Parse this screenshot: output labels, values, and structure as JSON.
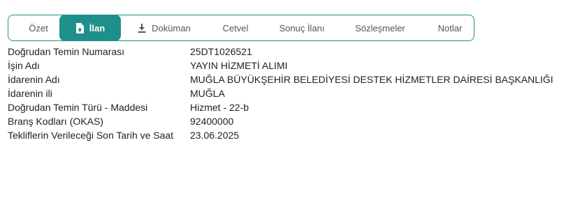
{
  "tabs": {
    "ozet": "Özet",
    "ilan": "İlan",
    "dokuman": "Doküman",
    "cetvel": "Cetvel",
    "sonuc_ilani": "Sonuç İlanı",
    "sozlesmeler": "Sözleşmeler",
    "notlar": "Notlar"
  },
  "info": {
    "rows": [
      {
        "label": "Doğrudan Temin Numarası",
        "value": "25DT1026521"
      },
      {
        "label": "İşin Adı",
        "value": "YAYIN HİZMETİ ALIMI"
      },
      {
        "label": "İdarenin Adı",
        "value": "MUĞLA BÜYÜKŞEHİR BELEDİYESİ DESTEK HİZMETLER DAİRESİ BAŞKANLIĞI"
      },
      {
        "label": "İdarenin ili",
        "value": "MUĞLA"
      },
      {
        "label": "Doğrudan Temin Türü - Maddesi",
        "value": "Hizmet - 22-b"
      },
      {
        "label": "Branş Kodları (OKAS)",
        "value": "92400000"
      },
      {
        "label": "Tekliflerin Verileceği Son Tarih ve Saat",
        "value": "23.06.2025"
      }
    ]
  },
  "colors": {
    "accent": "#1e8f8a",
    "border": "#1d8f8a"
  },
  "icons": {
    "ilan": "document-icon",
    "dokuman": "download-icon"
  }
}
